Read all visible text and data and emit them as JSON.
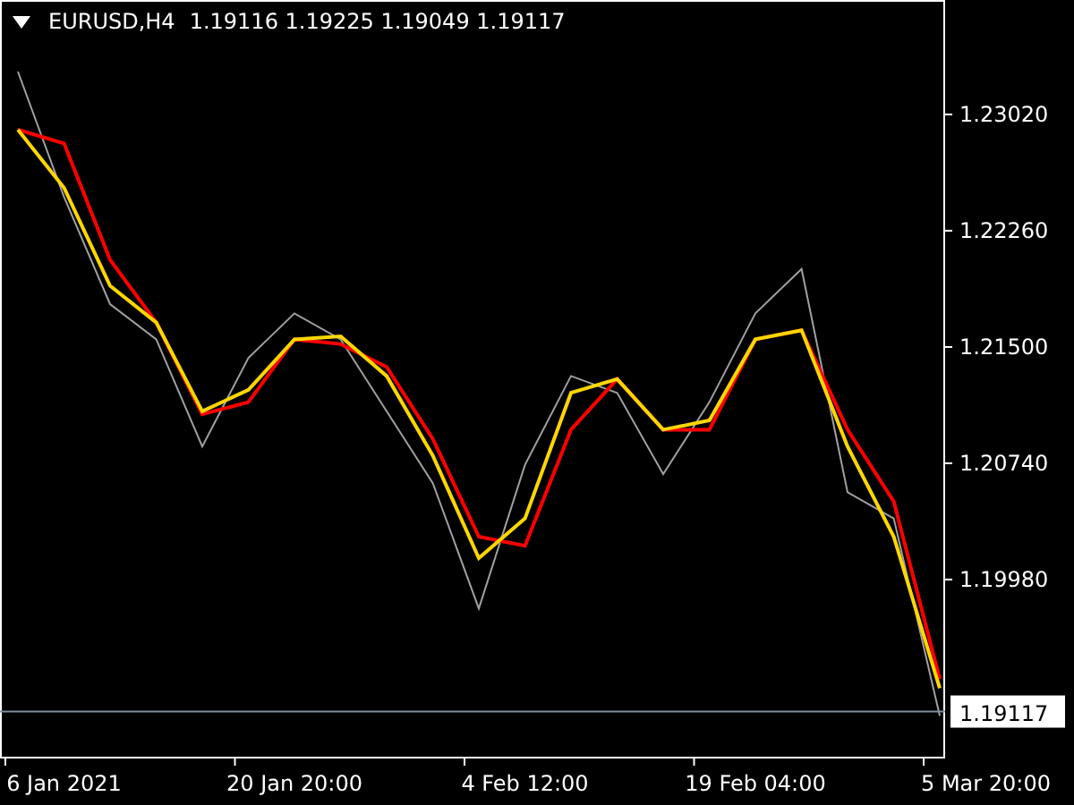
{
  "header": {
    "symbol": "EURUSD,H4",
    "quote": "1.19116 1.19225 1.19049 1.19117"
  },
  "chart_data": {
    "type": "line",
    "categories": [
      null,
      "6 Jan 2021",
      null,
      null,
      null,
      null,
      "20 Jan 20:00",
      null,
      null,
      null,
      null,
      "4 Feb 12:00",
      null,
      null,
      null,
      null,
      "19 Feb 04:00",
      null,
      null,
      null,
      null,
      "5 Mar 20:00"
    ],
    "series": [
      {
        "color": "#a0a0a0",
        "values": [
          1.233,
          1.2248,
          1.2178,
          1.2155,
          1.2085,
          1.2143,
          1.2172,
          1.2155,
          1.2108,
          1.2061,
          1.1979,
          1.2073,
          1.2131,
          1.212,
          1.2067,
          1.2114,
          1.2172,
          1.2201,
          1.2055,
          1.2038,
          1.1909,
          null
        ]
      },
      {
        "color": "#ff0000",
        "values": [
          1.2292,
          1.2283,
          1.2207,
          1.2166,
          1.2106,
          1.2114,
          1.2155,
          1.2152,
          1.2137,
          1.209,
          1.2026,
          1.202,
          1.2096,
          1.2129,
          1.2096,
          1.2096,
          1.2155,
          1.2161,
          1.2096,
          1.2049,
          1.1933,
          null
        ]
      },
      {
        "color": "#ffd700",
        "values": [
          1.2292,
          1.2254,
          1.219,
          1.2166,
          1.2108,
          1.2122,
          1.2155,
          1.2157,
          1.2131,
          1.2079,
          1.2012,
          1.2038,
          1.212,
          1.2129,
          1.2096,
          1.2102,
          1.2155,
          1.2161,
          1.2085,
          1.2026,
          1.1927,
          null
        ]
      }
    ],
    "ylim": [
      1.18822,
      1.23768
    ],
    "yticks": [
      {
        "value": 1.2302,
        "label": "1.23020"
      },
      {
        "value": 1.2226,
        "label": "1.22260"
      },
      {
        "value": 1.215,
        "label": "1.21500"
      },
      {
        "value": 1.2074,
        "label": "1.20740"
      },
      {
        "value": 1.1998,
        "label": "1.19980"
      }
    ],
    "ref_lines": [
      {
        "axis": "y",
        "value": 1.19117,
        "label": "1.19117"
      }
    ]
  }
}
